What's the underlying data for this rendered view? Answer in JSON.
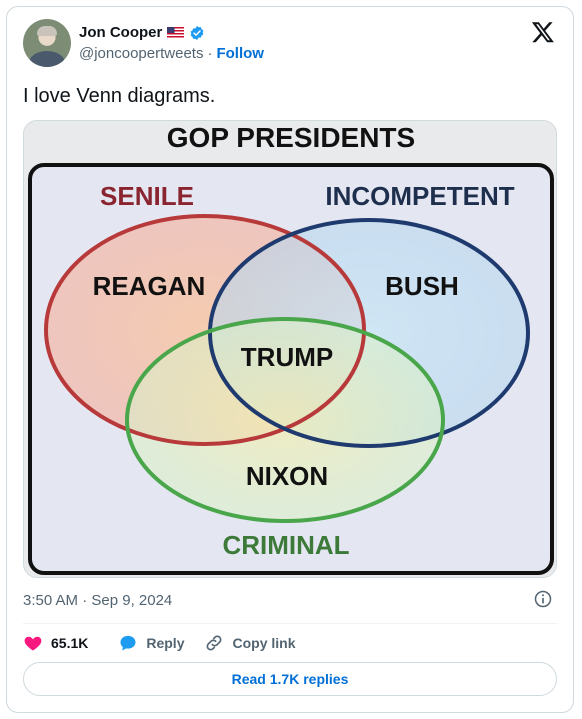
{
  "author": {
    "name": "Jon Cooper",
    "handle": "@joncoopertweets",
    "separator": "·",
    "follow_label": "Follow",
    "flag_icon": "us-flag-icon",
    "verified_color": "#1d9bf0"
  },
  "tweet": {
    "text": "I love Venn diagrams."
  },
  "image": {
    "title": "GOP PRESIDENTS",
    "sets": {
      "senile": "SENILE",
      "incompetent": "INCOMPETENT",
      "criminal": "CRIMINAL"
    },
    "regions": {
      "senile_only": "REAGAN",
      "incompetent_only": "BUSH",
      "all_three": "TRUMP",
      "criminal_only": "NIXON"
    },
    "colors": {
      "senile": "#b8393a",
      "incompetent": "#1e3a6e",
      "criminal": "#4aa64a"
    }
  },
  "meta": {
    "timestamp": "3:50 AM · Sep 9, 2024"
  },
  "actions": {
    "likes": "65.1K",
    "reply_label": "Reply",
    "copy_link_label": "Copy link",
    "like_color": "#f91880",
    "reply_color": "#1d9bf0"
  },
  "read_replies_label": "Read 1.7K replies"
}
